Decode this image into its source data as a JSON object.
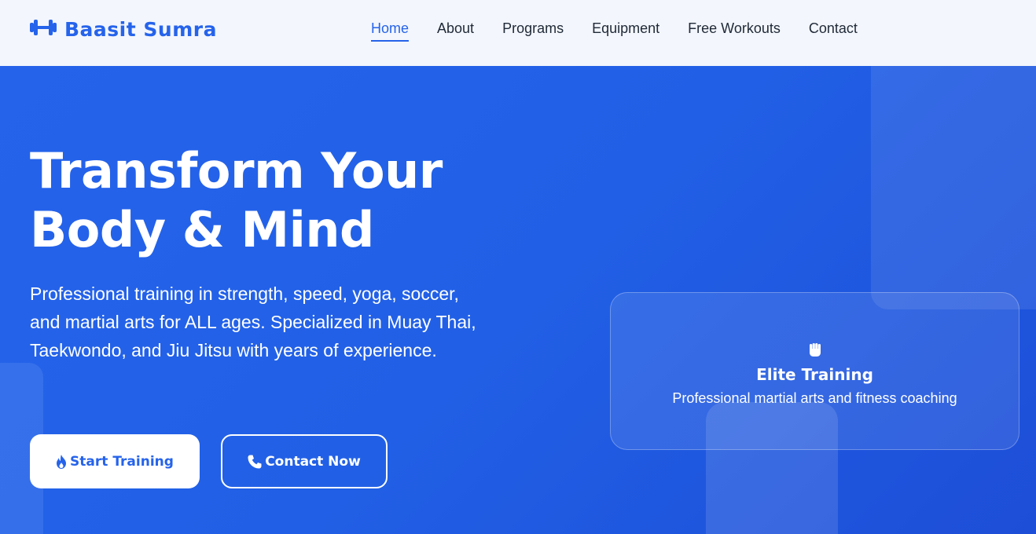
{
  "header": {
    "logo_text": "Baasit Sumra",
    "logo_icon": "dumbbell-icon",
    "nav": [
      {
        "label": "Home",
        "active": true
      },
      {
        "label": "About",
        "active": false
      },
      {
        "label": "Programs",
        "active": false
      },
      {
        "label": "Equipment",
        "active": false
      },
      {
        "label": "Free Workouts",
        "active": false
      },
      {
        "label": "Contact",
        "active": false
      }
    ]
  },
  "hero": {
    "title_line1": "Transform Your",
    "title_line2": "Body & Mind",
    "description": "Professional training in strength, speed, yoga, soccer, and martial arts for ALL ages. Specialized in Muay Thai, Taekwondo, and Jiu Jitsu with years of experience.",
    "primary_button": {
      "label": "Start Training",
      "icon": "fire-icon"
    },
    "secondary_button": {
      "label": "Contact Now",
      "icon": "phone-icon"
    }
  },
  "feature_card": {
    "icon": "fist-icon",
    "title": "Elite Training",
    "subtitle": "Professional martial arts and fitness coaching"
  },
  "colors": {
    "accent": "#2563eb",
    "header_bg": "#f3f6fc",
    "text_dark": "#1f2937",
    "white": "#ffffff"
  }
}
